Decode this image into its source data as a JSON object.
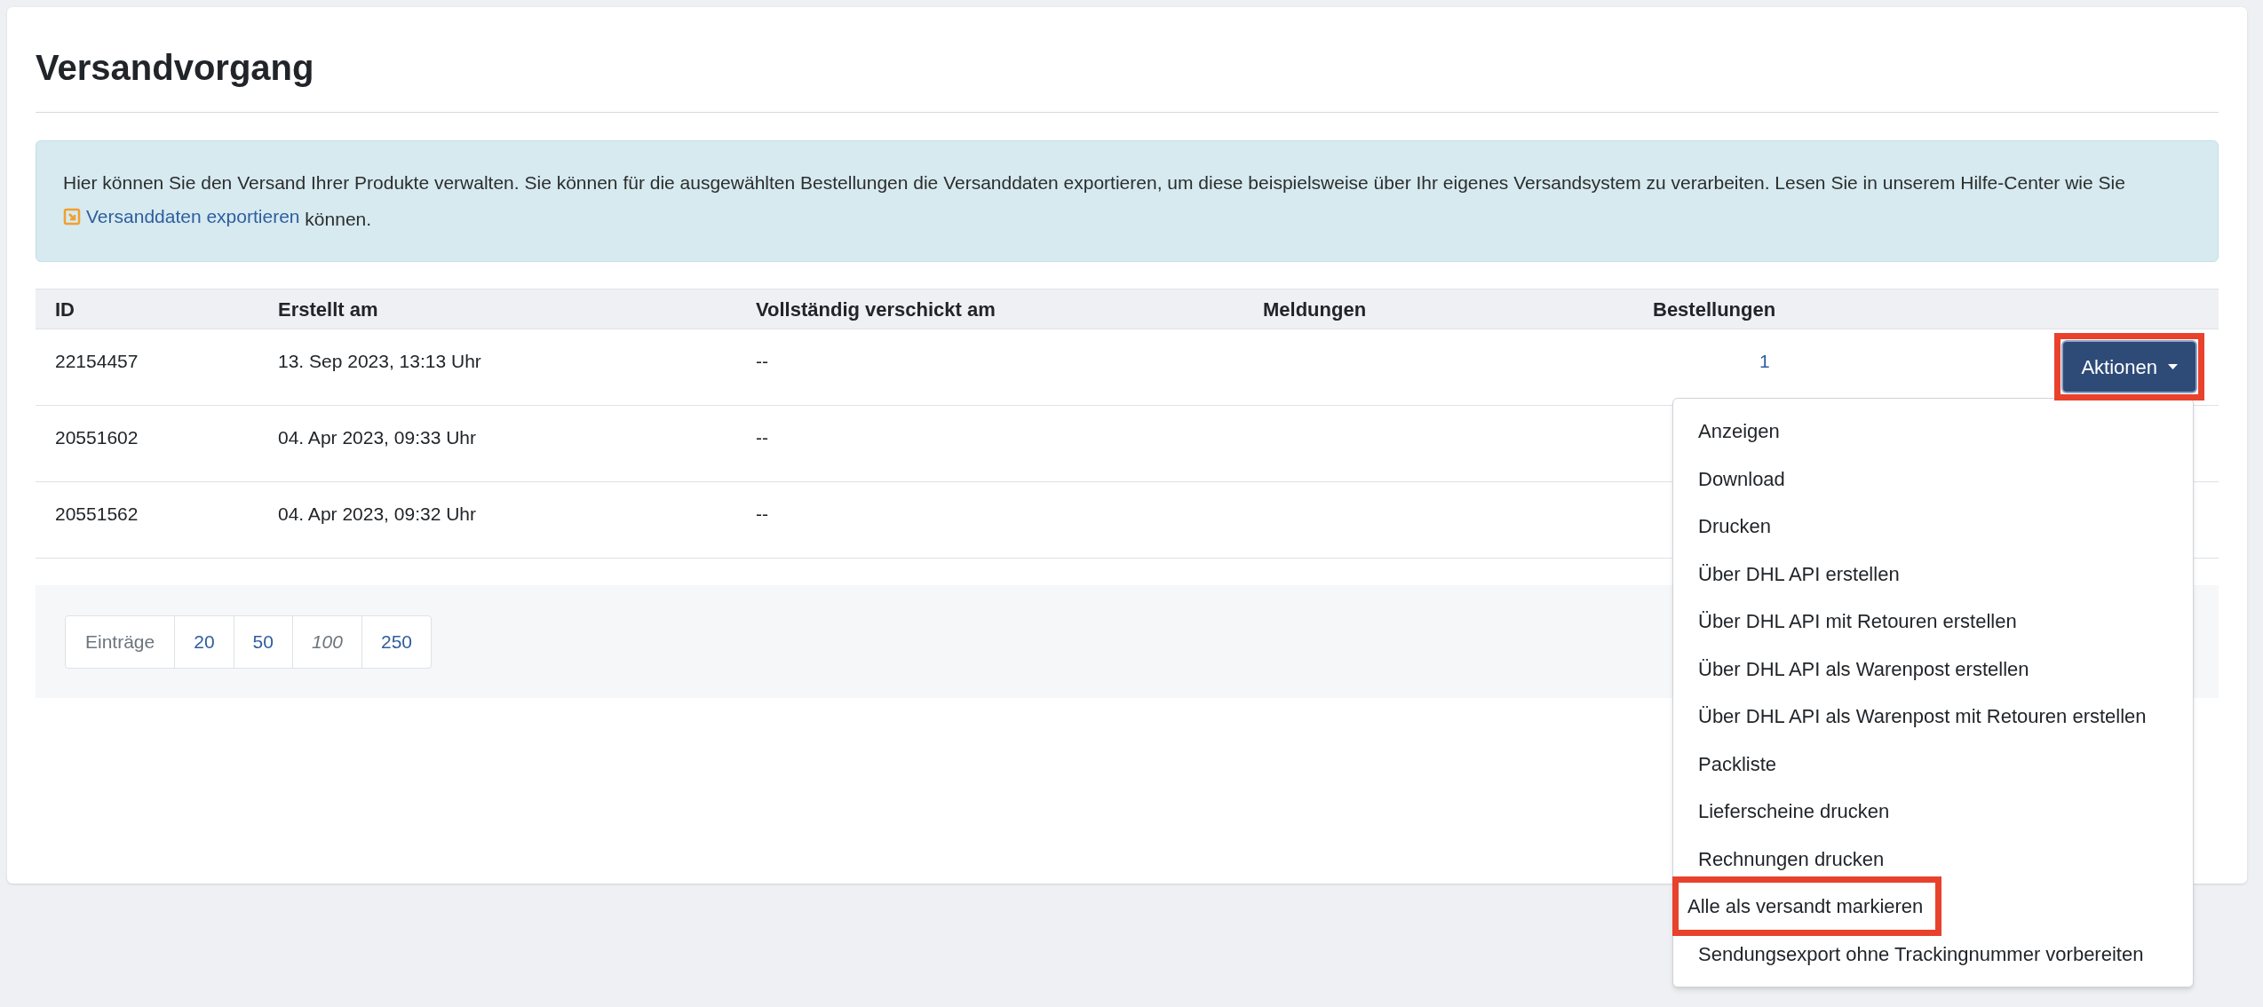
{
  "title": "Versandvorgang",
  "info": {
    "text": "Hier können Sie den Versand Ihrer Produkte verwalten. Sie können für die ausgewählten Bestellungen die Versanddaten exportieren, um diese beispielsweise über Ihr eigenes Versandsystem zu verarbeiten. Lesen Sie in unserem Hilfe-Center wie Sie",
    "link": "Versanddaten exportieren",
    "after": "können."
  },
  "table": {
    "columns": [
      "ID",
      "Erstellt am",
      "Vollständig verschickt am",
      "Meldungen",
      "Bestellungen"
    ],
    "rows": [
      {
        "id": "22154457",
        "created": "13. Sep 2023, 13:13 Uhr",
        "shipped": "--",
        "orders": "1"
      },
      {
        "id": "20551602",
        "created": "04. Apr 2023, 09:33 Uhr",
        "shipped": "--"
      },
      {
        "id": "20551562",
        "created": "04. Apr 2023, 09:32 Uhr",
        "shipped": "--"
      }
    ]
  },
  "actions": {
    "label": "Aktionen",
    "highlighted": true,
    "expanded": true,
    "menu": [
      {
        "label": "Anzeigen",
        "highlighted": false
      },
      {
        "label": "Download",
        "highlighted": false
      },
      {
        "label": "Drucken",
        "highlighted": false
      },
      {
        "label": "Über DHL API erstellen",
        "highlighted": false
      },
      {
        "label": "Über DHL API mit Retouren erstellen",
        "highlighted": false
      },
      {
        "label": "Über DHL API als Warenpost erstellen",
        "highlighted": false
      },
      {
        "label": "Über DHL API als Warenpost mit Retouren erstellen",
        "highlighted": false
      },
      {
        "label": "Packliste",
        "highlighted": false
      },
      {
        "label": "Lieferscheine drucken",
        "highlighted": false
      },
      {
        "label": "Rechnungen drucken",
        "highlighted": false
      },
      {
        "label": "Alle als versandt markieren",
        "highlighted": true
      },
      {
        "label": "Sendungsexport ohne Trackingnummer vorbereiten",
        "highlighted": false
      }
    ]
  },
  "pager": {
    "label": "Einträge",
    "options": [
      {
        "label": "20",
        "selected": false
      },
      {
        "label": "50",
        "selected": false
      },
      {
        "label": "100",
        "selected": true
      },
      {
        "label": "250",
        "selected": false
      }
    ]
  }
}
